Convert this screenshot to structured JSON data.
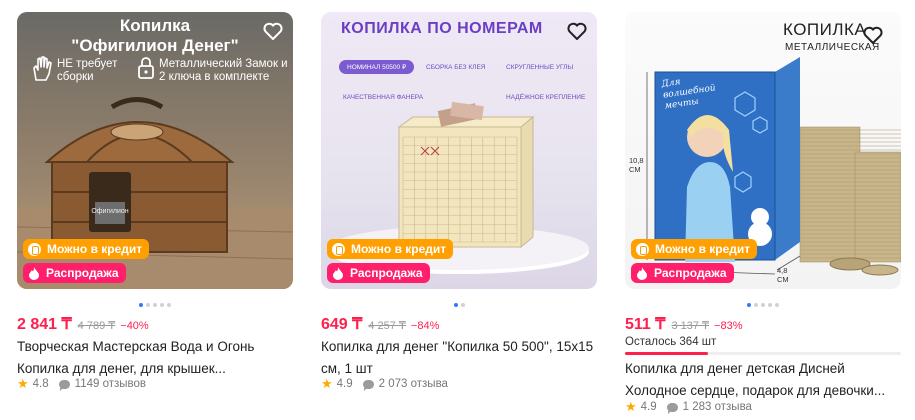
{
  "products": [
    {
      "image": {
        "title_line1": "Копилка",
        "title_line2": "\"Офигилион Денег\"",
        "feature1": "НЕ требует сборки",
        "feature2": "Металлический Замок и 2 ключа в комплекте",
        "chest_label": "Офигилион"
      },
      "badge_credit": "Можно в кредит",
      "badge_sale": "Распродажа",
      "price": "2 841 ₸",
      "old_price": "4 789 ₸",
      "discount": "−40%",
      "title_line1": "Творческая Мастерская Вода и Огонь",
      "title_line2": "Копилка для денег, для крышек...",
      "rating": "4.8",
      "reviews": "1149 отзывов",
      "dots": 5
    },
    {
      "image": {
        "headline": "КОПИЛКА ПО НОМЕРАМ",
        "tag1": "НОМИНАЛ 50500 ₽",
        "tag2": "СБОРКА БЕЗ КЛЕЯ",
        "tag3": "СКРУГЛЕННЫЕ УГЛЫ",
        "tag4": "КАЧЕСТВЕННАЯ ФАНЕРА",
        "tag5": "НАДЁЖНОЕ КРЕПЛЕНИЕ"
      },
      "badge_credit": "Можно в кредит",
      "badge_sale": "Распродажа",
      "price": "649 ₸",
      "old_price": "4 257 ₸",
      "discount": "−84%",
      "title_line1": "Копилка для денег \"Копилка 50 500\", 15x15",
      "title_line2": "см, 1 шт",
      "rating": "4.9",
      "reviews": "2 073 отзыва",
      "dots": 2
    },
    {
      "image": {
        "brand_line1": "КОПИЛКА",
        "brand_line2": "МЕТАЛЛИЧЕСКАЯ",
        "dim_height": "10,8 СМ",
        "dim_depth": "4,8 СМ",
        "tin_caption": "Для волшебной мечты"
      },
      "badge_credit": "Можно в кредит",
      "badge_sale": "Распродажа",
      "price": "511 ₸",
      "old_price": "3 137 ₸",
      "discount": "−83%",
      "stock_left": "Осталось 364 шт",
      "stock_fraction": 0.3,
      "title_line1": "Копилка для денег детская Дисней",
      "title_line2": "Холодное сердце, подарок для девочки...",
      "rating": "4.9",
      "reviews": "1 283 отзыва",
      "dots": 5
    }
  ]
}
